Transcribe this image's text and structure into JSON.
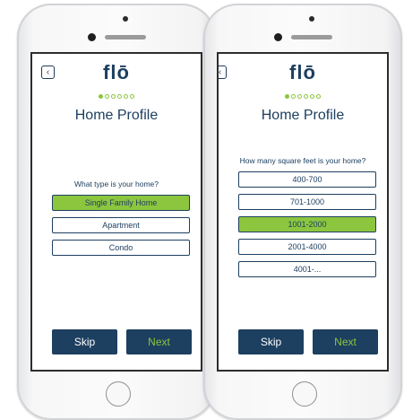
{
  "screens": [
    {
      "logo": "flō",
      "title": "Home Profile",
      "progress": {
        "total": 6,
        "current": 1
      },
      "question": "What type is your home?",
      "options": [
        {
          "label": "Single Family Home",
          "selected": true
        },
        {
          "label": "Apartment",
          "selected": false
        },
        {
          "label": "Condo",
          "selected": false
        }
      ],
      "skip_label": "Skip",
      "next_label": "Next"
    },
    {
      "logo": "flō",
      "title": "Home Profile",
      "progress": {
        "total": 6,
        "current": 1
      },
      "question": "How many square feet is your home?",
      "options": [
        {
          "label": "400-700",
          "selected": false
        },
        {
          "label": "701-1000",
          "selected": false
        },
        {
          "label": "1001-2000",
          "selected": true
        },
        {
          "label": "2001-4000",
          "selected": false
        },
        {
          "label": "4001-...",
          "selected": false
        }
      ],
      "skip_label": "Skip",
      "next_label": "Next"
    }
  ],
  "colors": {
    "navy": "#1d3f60",
    "green": "#8cc63f"
  }
}
